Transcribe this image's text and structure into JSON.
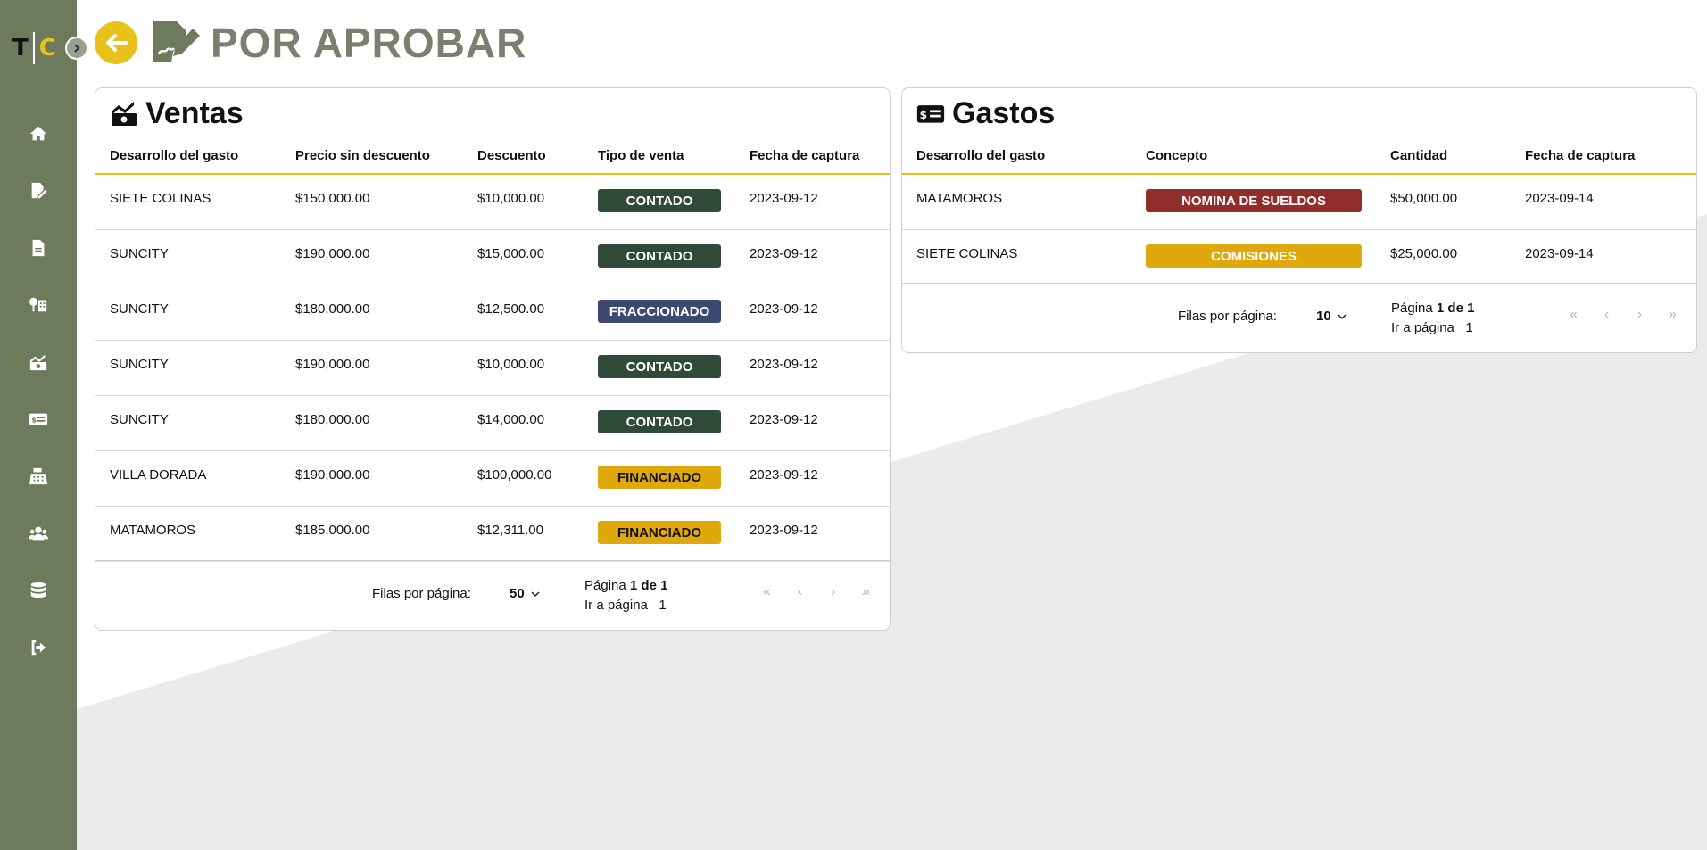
{
  "header": {
    "title": "POR APROBAR"
  },
  "logo": {
    "left": "T",
    "right": "C"
  },
  "sidebar": {
    "items": [
      {
        "icon": "home-icon"
      },
      {
        "icon": "edit-document-icon"
      },
      {
        "icon": "file-icon"
      },
      {
        "icon": "trees-building-icon"
      },
      {
        "icon": "money-chart-icon"
      },
      {
        "icon": "money-card-icon"
      },
      {
        "icon": "cash-register-icon"
      },
      {
        "icon": "users-icon"
      },
      {
        "icon": "database-icon"
      },
      {
        "icon": "logout-icon"
      }
    ]
  },
  "colors": {
    "sidebar": "#6e7a5c",
    "accent": "#e8c21a",
    "contado": "#2f4a39",
    "fraccionado": "#3c4a72",
    "financiado": "#dfa80c",
    "nomina": "#8f2e2b"
  },
  "ventas": {
    "title": "Ventas",
    "columns": [
      "Desarrollo del gasto",
      "Precio sin descuento",
      "Descuento",
      "Tipo de venta",
      "Fecha de captura"
    ],
    "rows": [
      {
        "desarrollo": "SIETE COLINAS",
        "precio": "$150,000.00",
        "descuento": "$10,000.00",
        "tipo": "CONTADO",
        "fecha": "2023-09-12"
      },
      {
        "desarrollo": "SUNCITY",
        "precio": "$190,000.00",
        "descuento": "$15,000.00",
        "tipo": "CONTADO",
        "fecha": "2023-09-12"
      },
      {
        "desarrollo": "SUNCITY",
        "precio": "$180,000.00",
        "descuento": "$12,500.00",
        "tipo": "FRACCIONADO",
        "fecha": "2023-09-12"
      },
      {
        "desarrollo": "SUNCITY",
        "precio": "$190,000.00",
        "descuento": "$10,000.00",
        "tipo": "CONTADO",
        "fecha": "2023-09-12"
      },
      {
        "desarrollo": "SUNCITY",
        "precio": "$180,000.00",
        "descuento": "$14,000.00",
        "tipo": "CONTADO",
        "fecha": "2023-09-12"
      },
      {
        "desarrollo": "VILLA DORADA",
        "precio": "$190,000.00",
        "descuento": "$100,000.00",
        "tipo": "FINANCIADO",
        "fecha": "2023-09-12"
      },
      {
        "desarrollo": "MATAMOROS",
        "precio": "$185,000.00",
        "descuento": "$12,311.00",
        "tipo": "FINANCIADO",
        "fecha": "2023-09-12"
      }
    ],
    "pager": {
      "rows_label": "Filas por página:",
      "rows_value": "50",
      "page_label": "Página",
      "page_value": "1 de 1",
      "goto_label": "Ir a página",
      "goto_value": "1"
    }
  },
  "gastos": {
    "title": "Gastos",
    "columns": [
      "Desarrollo del gasto",
      "Concepto",
      "Cantidad",
      "Fecha de captura"
    ],
    "rows": [
      {
        "desarrollo": "MATAMOROS",
        "concepto": "NOMINA DE SUELDOS",
        "cantidad": "$50,000.00",
        "fecha": "2023-09-14"
      },
      {
        "desarrollo": "SIETE COLINAS",
        "concepto": "COMISIONES",
        "cantidad": "$25,000.00",
        "fecha": "2023-09-14"
      }
    ],
    "pager": {
      "rows_label": "Filas por página:",
      "rows_value": "10",
      "page_label": "Página",
      "page_value": "1 de 1",
      "goto_label": "Ir a página",
      "goto_value": "1"
    }
  }
}
